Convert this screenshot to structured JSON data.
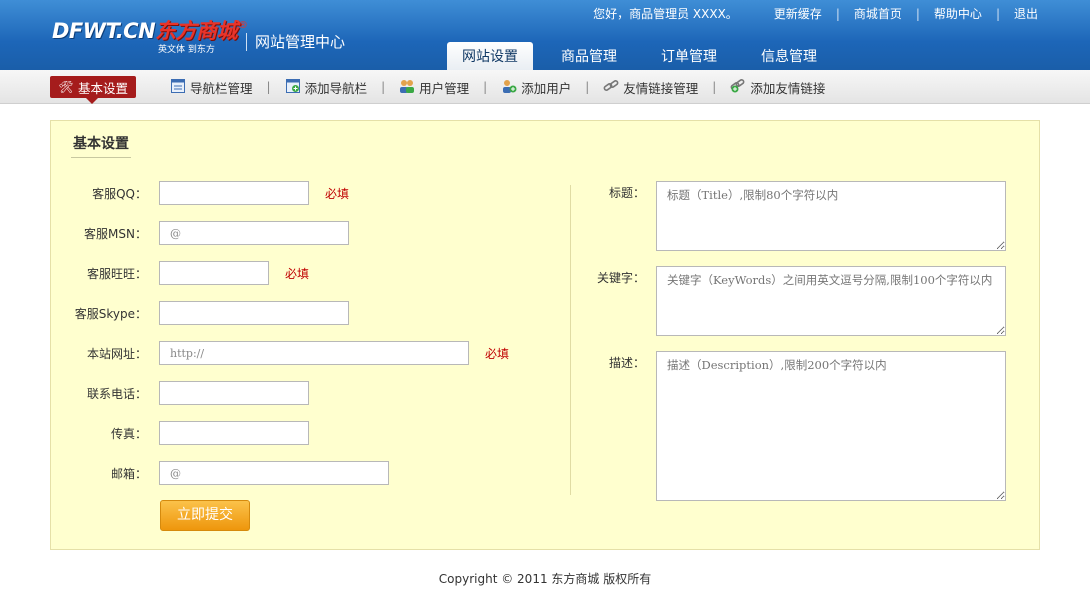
{
  "header": {
    "logo_en": "DFWT.CN",
    "logo_cn": "东方商城",
    "logo_sub": "英文体 到东方",
    "site_title": "网站管理中心",
    "top_links": {
      "greeting": "您好，商品管理员 XXXX。",
      "refresh_cache": "更新缓存",
      "shop_home": "商城首页",
      "help": "帮助中心",
      "logout": "退出"
    },
    "tabs": [
      {
        "label": "网站设置",
        "active": true
      },
      {
        "label": "商品管理",
        "active": false
      },
      {
        "label": "订单管理",
        "active": false
      },
      {
        "label": "信息管理",
        "active": false
      }
    ]
  },
  "subnav": {
    "items": [
      {
        "label": "基本设置",
        "icon": "tools-icon",
        "active": true
      },
      {
        "label": "导航栏管理",
        "icon": "window-icon",
        "active": false
      },
      {
        "label": "添加导航栏",
        "icon": "window-add-icon",
        "active": false
      },
      {
        "label": "用户管理",
        "icon": "users-icon",
        "active": false
      },
      {
        "label": "添加用户",
        "icon": "user-add-icon",
        "active": false
      },
      {
        "label": "友情链接管理",
        "icon": "link-icon",
        "active": false
      },
      {
        "label": "添加友情链接",
        "icon": "link-add-icon",
        "active": false
      }
    ]
  },
  "form": {
    "title": "基本设置",
    "required_label": "必填",
    "fields": {
      "qq": {
        "label": "客服QQ：",
        "value": ""
      },
      "msn": {
        "label": "客服MSN：",
        "value": "@"
      },
      "wangwang": {
        "label": "客服旺旺：",
        "value": ""
      },
      "skype": {
        "label": "客服Skype：",
        "value": ""
      },
      "site_url": {
        "label": "本站网址：",
        "value": "http://"
      },
      "phone": {
        "label": "联系电话：",
        "value": ""
      },
      "fax": {
        "label": "传真：",
        "value": ""
      },
      "email": {
        "label": "邮箱：",
        "value": "@"
      }
    },
    "seo": {
      "title": {
        "label": "标题：",
        "placeholder": "标题（Title）,限制80个字符以内"
      },
      "keywords": {
        "label": "关键字：",
        "placeholder": "关键字（KeyWords）之间用英文逗号分隔,限制100个字符以内"
      },
      "description": {
        "label": "描述：",
        "placeholder": "描述（Description）,限制200个字符以内"
      }
    },
    "submit_label": "立即提交"
  },
  "footer": {
    "copyright": "Copyright © 2011 东方商城 版权所有"
  }
}
